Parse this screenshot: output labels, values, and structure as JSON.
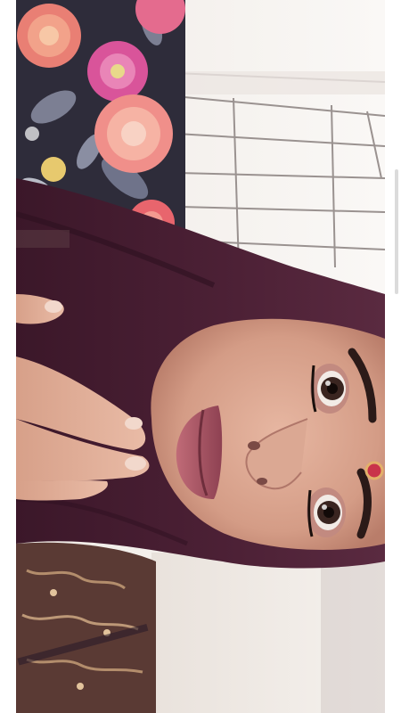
{
  "image": {
    "orientation": "rotated-90-clockwise",
    "subject": "portrait"
  },
  "colors": {
    "hijab": "#4a1f35",
    "skin": "#d9a48d",
    "lips": "#b5606e",
    "floral_fabric_bg": "#2e2c3a",
    "peony_pink": "#e07a8a",
    "wall": "#f1ece8",
    "window_sky": "#f7f5f2",
    "embroidered_dress": "#5a3a34",
    "screen_border": "#ffffff"
  }
}
